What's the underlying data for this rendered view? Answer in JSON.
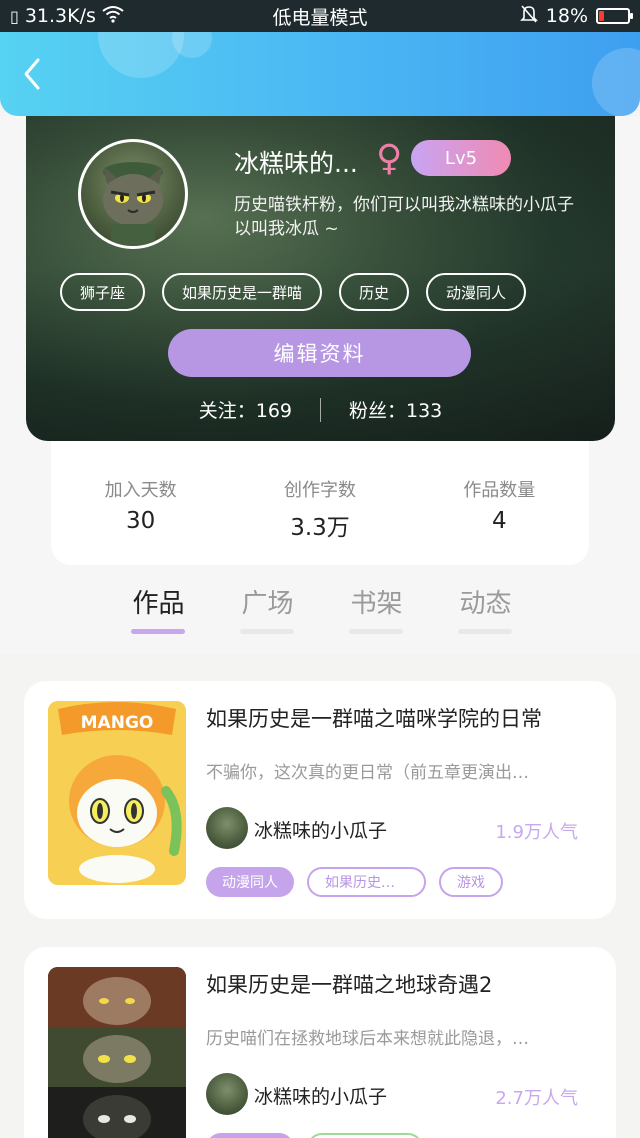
{
  "status_bar": {
    "speed": "31.3K/s",
    "mode": "低电量模式",
    "battery": "18%",
    "battery_level": 0.18
  },
  "header": {
    "back_icon": "chevron-left-icon"
  },
  "profile": {
    "username": "冰糕味的...",
    "gender_icon": "female-symbol",
    "level": "Lv5",
    "bio": "历史喵铁杆粉，你们可以叫我冰糕味的小瓜子\n以叫我冰瓜 ~",
    "tags": [
      "狮子座",
      "如果历史是一群喵",
      "历史",
      "动漫同人"
    ],
    "edit_button": "编辑资料",
    "following_label": "关注：169",
    "followers_label": "粉丝：133"
  },
  "stats": [
    {
      "label": "加入天数",
      "value": "30"
    },
    {
      "label": "创作字数",
      "value": "3.3万"
    },
    {
      "label": "作品数量",
      "value": "4"
    }
  ],
  "tabs": [
    {
      "label": "作品",
      "active": true
    },
    {
      "label": "广场",
      "active": false
    },
    {
      "label": "书架",
      "active": false
    },
    {
      "label": "动态",
      "active": false
    }
  ],
  "works": [
    {
      "title": "如果历史是一群喵之喵咪学院的日常",
      "desc": "不骗你，这次真的更日常（前五章更演出…",
      "author": "冰糕味的小瓜子",
      "popularity": "1.9万人气",
      "cover_text": "MANGO",
      "tags": [
        "动漫同人",
        "如果历史…",
        "游戏"
      ]
    },
    {
      "title": "如果历史是一群喵之地球奇遇2",
      "desc": "历史喵们在拯救地球后本来想就此隐退，…",
      "author": "冰糕味的小瓜子",
      "popularity": "2.7万人气"
    }
  ],
  "colors": {
    "header": "#4ab6f3",
    "accent_purple": "#c5a4ec",
    "battery_low": "#ff3b30"
  }
}
